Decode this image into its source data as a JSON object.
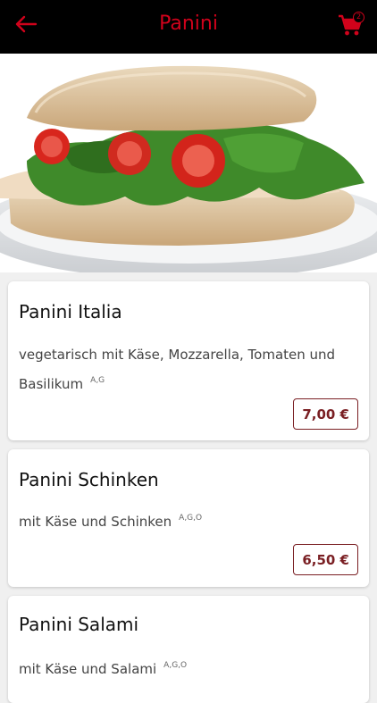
{
  "header": {
    "title": "Panini",
    "back_icon": "arrow-left-icon",
    "cart_icon": "shopping-cart-icon",
    "cart_count": "2",
    "accent_color": "#d0021b"
  },
  "hero": {
    "image": "panini-sandwich-photo"
  },
  "products": [
    {
      "name": "Panini Italia",
      "description": "vegetarisch mit Käse, Mozzarella, Tomaten und Basilikum",
      "allergens": "A,G",
      "price": "7,00 €"
    },
    {
      "name": "Panini Schinken",
      "description": "mit Käse und Schinken",
      "allergens": "A,G,O",
      "price": "6,50 €"
    },
    {
      "name": "Panini Salami",
      "description": "mit Käse und Salami",
      "allergens": "A,G,O"
    }
  ]
}
